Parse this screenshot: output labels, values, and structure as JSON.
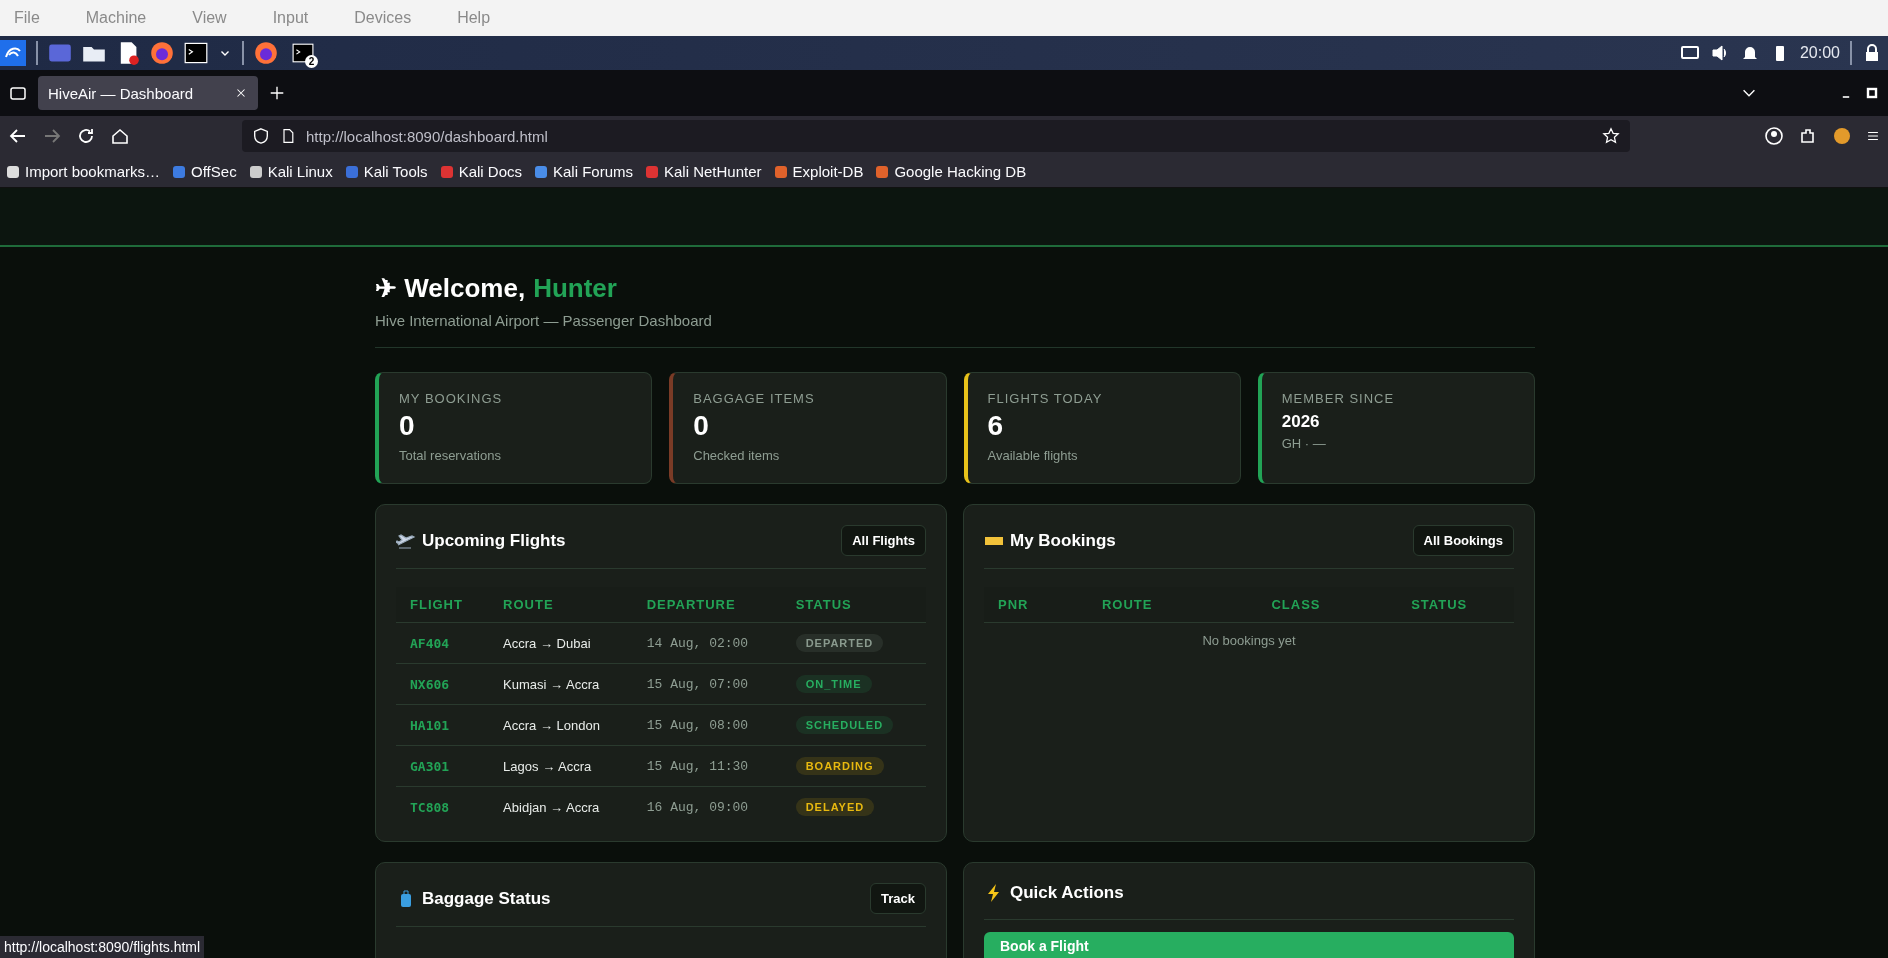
{
  "vm_menu": [
    "File",
    "Machine",
    "View",
    "Input",
    "Devices",
    "Help"
  ],
  "taskbar": {
    "badge": "2",
    "clock": "20:00"
  },
  "browser": {
    "tab": {
      "title": "HiveAir — Dashboard",
      "selected": true
    },
    "url": "http://localhost:8090/dashboard.html",
    "bookmarks": [
      "Import bookmarks…",
      "OffSec",
      "Kali Linux",
      "Kali Tools",
      "Kali Docs",
      "Kali Forums",
      "Kali NetHunter",
      "Exploit-DB",
      "Google Hacking DB"
    ],
    "status_url": "http://localhost:8090/flights.html"
  },
  "welcome": {
    "icon": "✈",
    "greeting": "Welcome,",
    "name": "Hunter",
    "subtitle": "Hive International Airport — Passenger Dashboard"
  },
  "stats": [
    {
      "label": "MY BOOKINGS",
      "value": "0",
      "note": "Total reservations",
      "color": "#22a356",
      "kind": "big"
    },
    {
      "label": "BAGGAGE ITEMS",
      "value": "0",
      "note": "Checked items",
      "color": "#7a3b26",
      "kind": "big"
    },
    {
      "label": "FLIGHTS TODAY",
      "value": "6",
      "note": "Available flights",
      "color": "#e8c21a",
      "kind": "big"
    },
    {
      "label": "MEMBER SINCE",
      "value": "2026",
      "note": "GH · —",
      "color": "#22a356",
      "kind": "small"
    }
  ],
  "flights": {
    "title": "Upcoming Flights",
    "button": "All Flights",
    "columns": [
      "FLIGHT",
      "ROUTE",
      "DEPARTURE",
      "STATUS"
    ],
    "rows": [
      {
        "flight": "AF404",
        "route": "Accra → Dubai",
        "departure": "14 Aug, 02:00",
        "status": "DEPARTED",
        "color": "#8a9a8e"
      },
      {
        "flight": "NX606",
        "route": "Kumasi → Accra",
        "departure": "15 Aug, 07:00",
        "status": "ON_TIME",
        "color": "#27ae60"
      },
      {
        "flight": "HA101",
        "route": "Accra → London",
        "departure": "15 Aug, 08:00",
        "status": "SCHEDULED",
        "color": "#27ae60"
      },
      {
        "flight": "GA301",
        "route": "Lagos → Accra",
        "departure": "15 Aug, 11:30",
        "status": "BOARDING",
        "color": "#e8b90f"
      },
      {
        "flight": "TC808",
        "route": "Abidjan → Accra",
        "departure": "16 Aug, 09:00",
        "status": "DELAYED",
        "color": "#e8b90f"
      }
    ]
  },
  "bookings": {
    "title": "My Bookings",
    "button": "All Bookings",
    "columns": [
      "PNR",
      "ROUTE",
      "CLASS",
      "STATUS"
    ],
    "empty": "No bookings yet"
  },
  "baggage": {
    "title": "Baggage Status",
    "button": "Track"
  },
  "quick_actions": {
    "title": "Quick Actions",
    "actions": [
      "Book a Flight"
    ]
  }
}
